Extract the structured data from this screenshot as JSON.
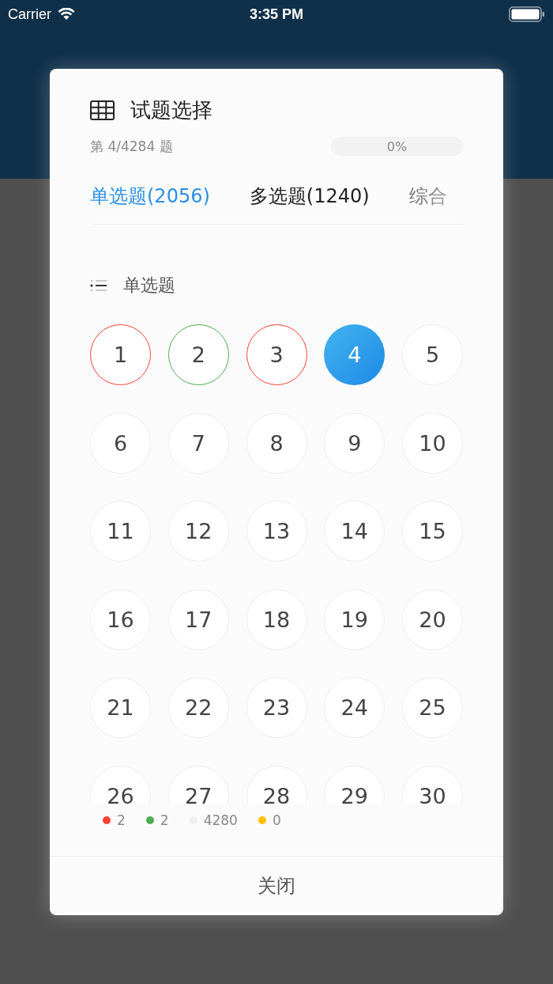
{
  "status_bar": {
    "carrier": "Carrier",
    "time": "3:35 PM"
  },
  "dialog": {
    "title": "试题选择",
    "position": "第 4/4284 题",
    "progress": {
      "level": 0,
      "reading": "0%"
    },
    "tabs": [
      {
        "label": "单选题(2056)",
        "selected": true
      },
      {
        "label": "多选题(1240)",
        "selected": false
      },
      {
        "label": "综合",
        "selected": false
      }
    ],
    "section": "单选题",
    "questions": [
      {
        "number": "1",
        "selected": false,
        "color": "#f44336"
      },
      {
        "number": "2",
        "selected": false,
        "color": "#4caf50"
      },
      {
        "number": "3",
        "selected": false,
        "color": "#f44336"
      },
      {
        "number": "4",
        "selected": true
      },
      {
        "number": "5",
        "selected": false
      },
      {
        "number": "6",
        "selected": false
      },
      {
        "number": "7",
        "selected": false
      },
      {
        "number": "8",
        "selected": false
      },
      {
        "number": "9",
        "selected": false
      },
      {
        "number": "10",
        "selected": false
      },
      {
        "number": "11",
        "selected": false
      },
      {
        "number": "12",
        "selected": false
      },
      {
        "number": "13",
        "selected": false
      },
      {
        "number": "14",
        "selected": false
      },
      {
        "number": "15",
        "selected": false
      },
      {
        "number": "16",
        "selected": false
      },
      {
        "number": "17",
        "selected": false
      },
      {
        "number": "18",
        "selected": false
      },
      {
        "number": "19",
        "selected": false
      },
      {
        "number": "20",
        "selected": false
      },
      {
        "number": "21",
        "selected": false
      },
      {
        "number": "22",
        "selected": false
      },
      {
        "number": "23",
        "selected": false
      },
      {
        "number": "24",
        "selected": false
      },
      {
        "number": "25",
        "selected": false
      },
      {
        "number": "26",
        "selected": false
      },
      {
        "number": "27",
        "selected": false
      },
      {
        "number": "28",
        "selected": false
      },
      {
        "number": "29",
        "selected": false
      },
      {
        "number": "30",
        "selected": false
      }
    ],
    "legend": [
      {
        "color": "#f44336",
        "count": "2"
      },
      {
        "color": "#4caf50",
        "count": "2"
      },
      {
        "color": "#eeeeee",
        "count": "4280"
      },
      {
        "color": "#ffc107",
        "count": "0"
      }
    ],
    "close_button": "关闭"
  }
}
